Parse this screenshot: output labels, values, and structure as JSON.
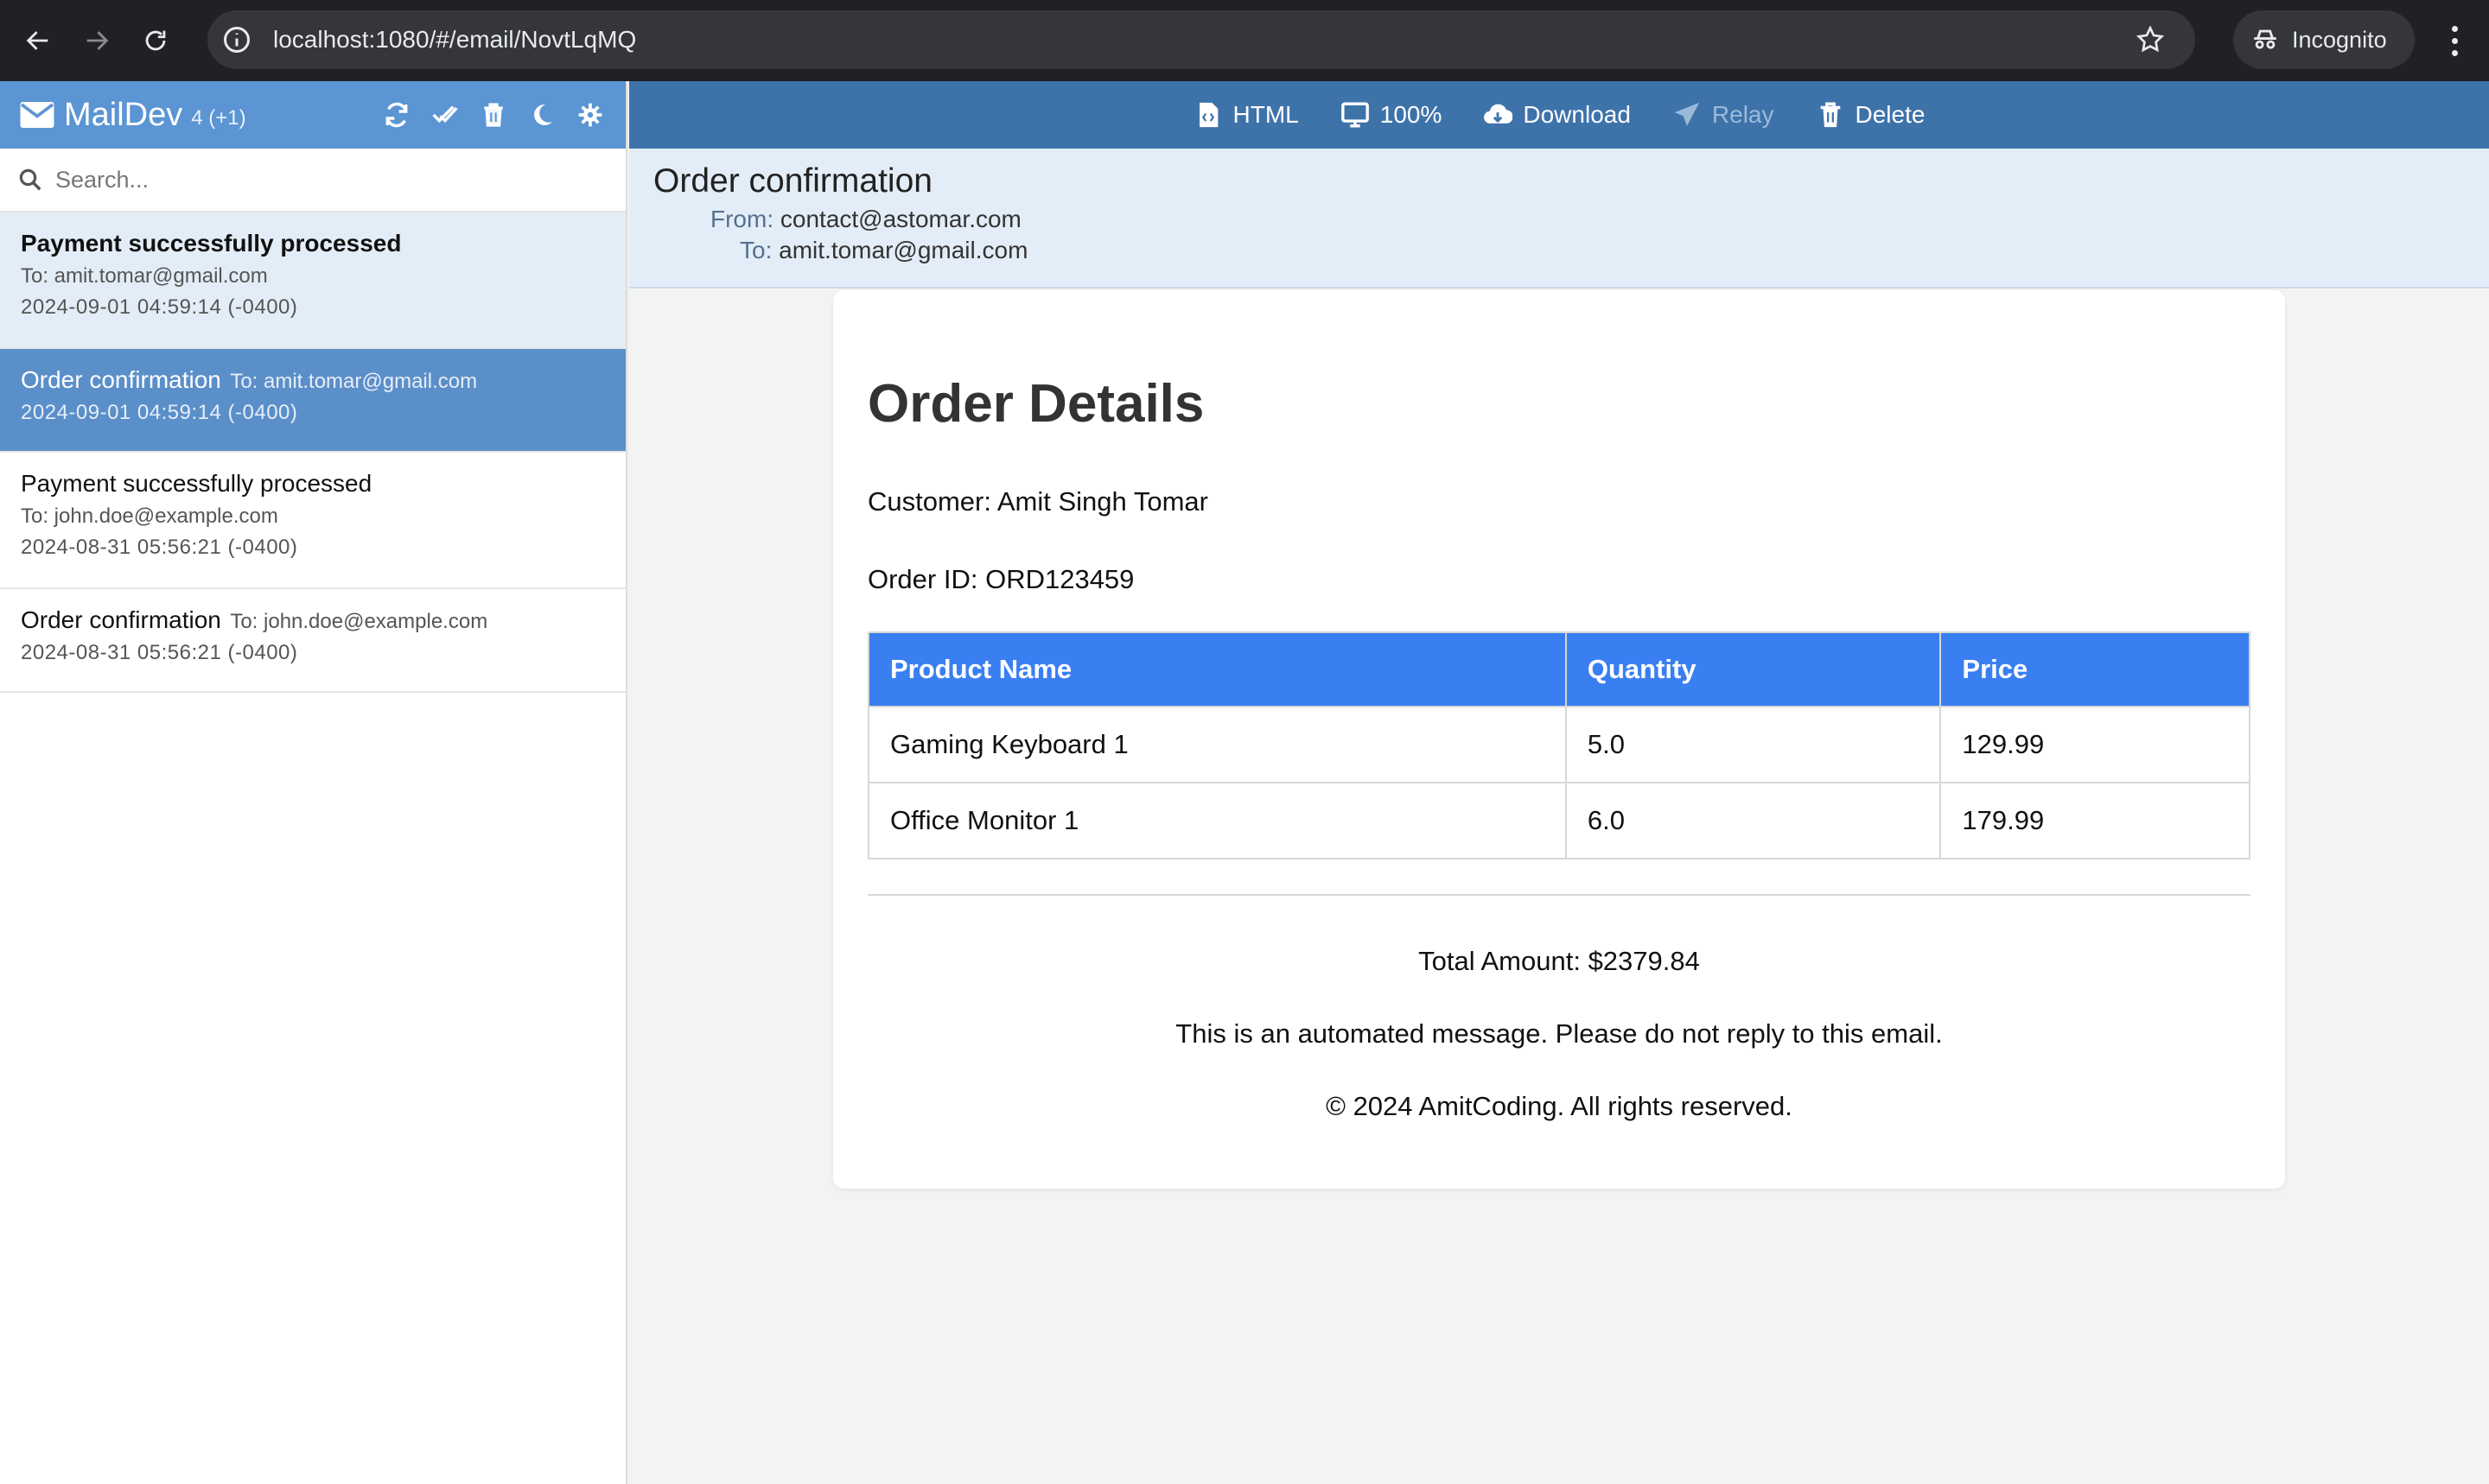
{
  "browser": {
    "url": "localhost:1080/#/email/NovtLqMQ",
    "incognito_label": "Incognito"
  },
  "sidebar": {
    "app_name": "MailDev",
    "count": "4 (+1)",
    "search_placeholder": "Search...",
    "emails": [
      {
        "subject": "Payment successfully processed",
        "to": "To: amit.tomar@gmail.com",
        "date": "2024-09-01 04:59:14 (-0400)"
      },
      {
        "subject": "Order confirmation",
        "to": "To: amit.tomar@gmail.com",
        "date": "2024-09-01 04:59:14 (-0400)"
      },
      {
        "subject": "Payment successfully processed",
        "to": "To: john.doe@example.com",
        "date": "2024-08-31 05:56:21 (-0400)"
      },
      {
        "subject": "Order confirmation",
        "to": "To: john.doe@example.com",
        "date": "2024-08-31 05:56:21 (-0400)"
      }
    ]
  },
  "toolbar": {
    "html_label": "HTML",
    "zoom_label": "100%",
    "download_label": "Download",
    "relay_label": "Relay",
    "delete_label": "Delete"
  },
  "email": {
    "subject": "Order confirmation",
    "from_label": "From:",
    "from": "contact@astomar.com",
    "to_label": "To:",
    "to": "amit.tomar@gmail.com"
  },
  "body": {
    "title": "Order Details",
    "customer": "Customer: Amit Singh Tomar",
    "order_id": "Order ID: ORD123459",
    "table": {
      "headers": [
        "Product Name",
        "Quantity",
        "Price"
      ],
      "rows": [
        [
          "Gaming Keyboard 1",
          "5.0",
          "129.99"
        ],
        [
          "Office Monitor 1",
          "6.0",
          "179.99"
        ]
      ]
    },
    "total": "Total Amount: $2379.84",
    "note": "This is an automated message. Please do not reply to this email.",
    "copyright": "© 2024 AmitCoding. All rights reserved."
  },
  "colors": {
    "sidebar_header": "#5b95d3",
    "toolbar": "#3e73aa",
    "active_item": "#5b8fc9",
    "table_header": "#3a7ff2"
  }
}
